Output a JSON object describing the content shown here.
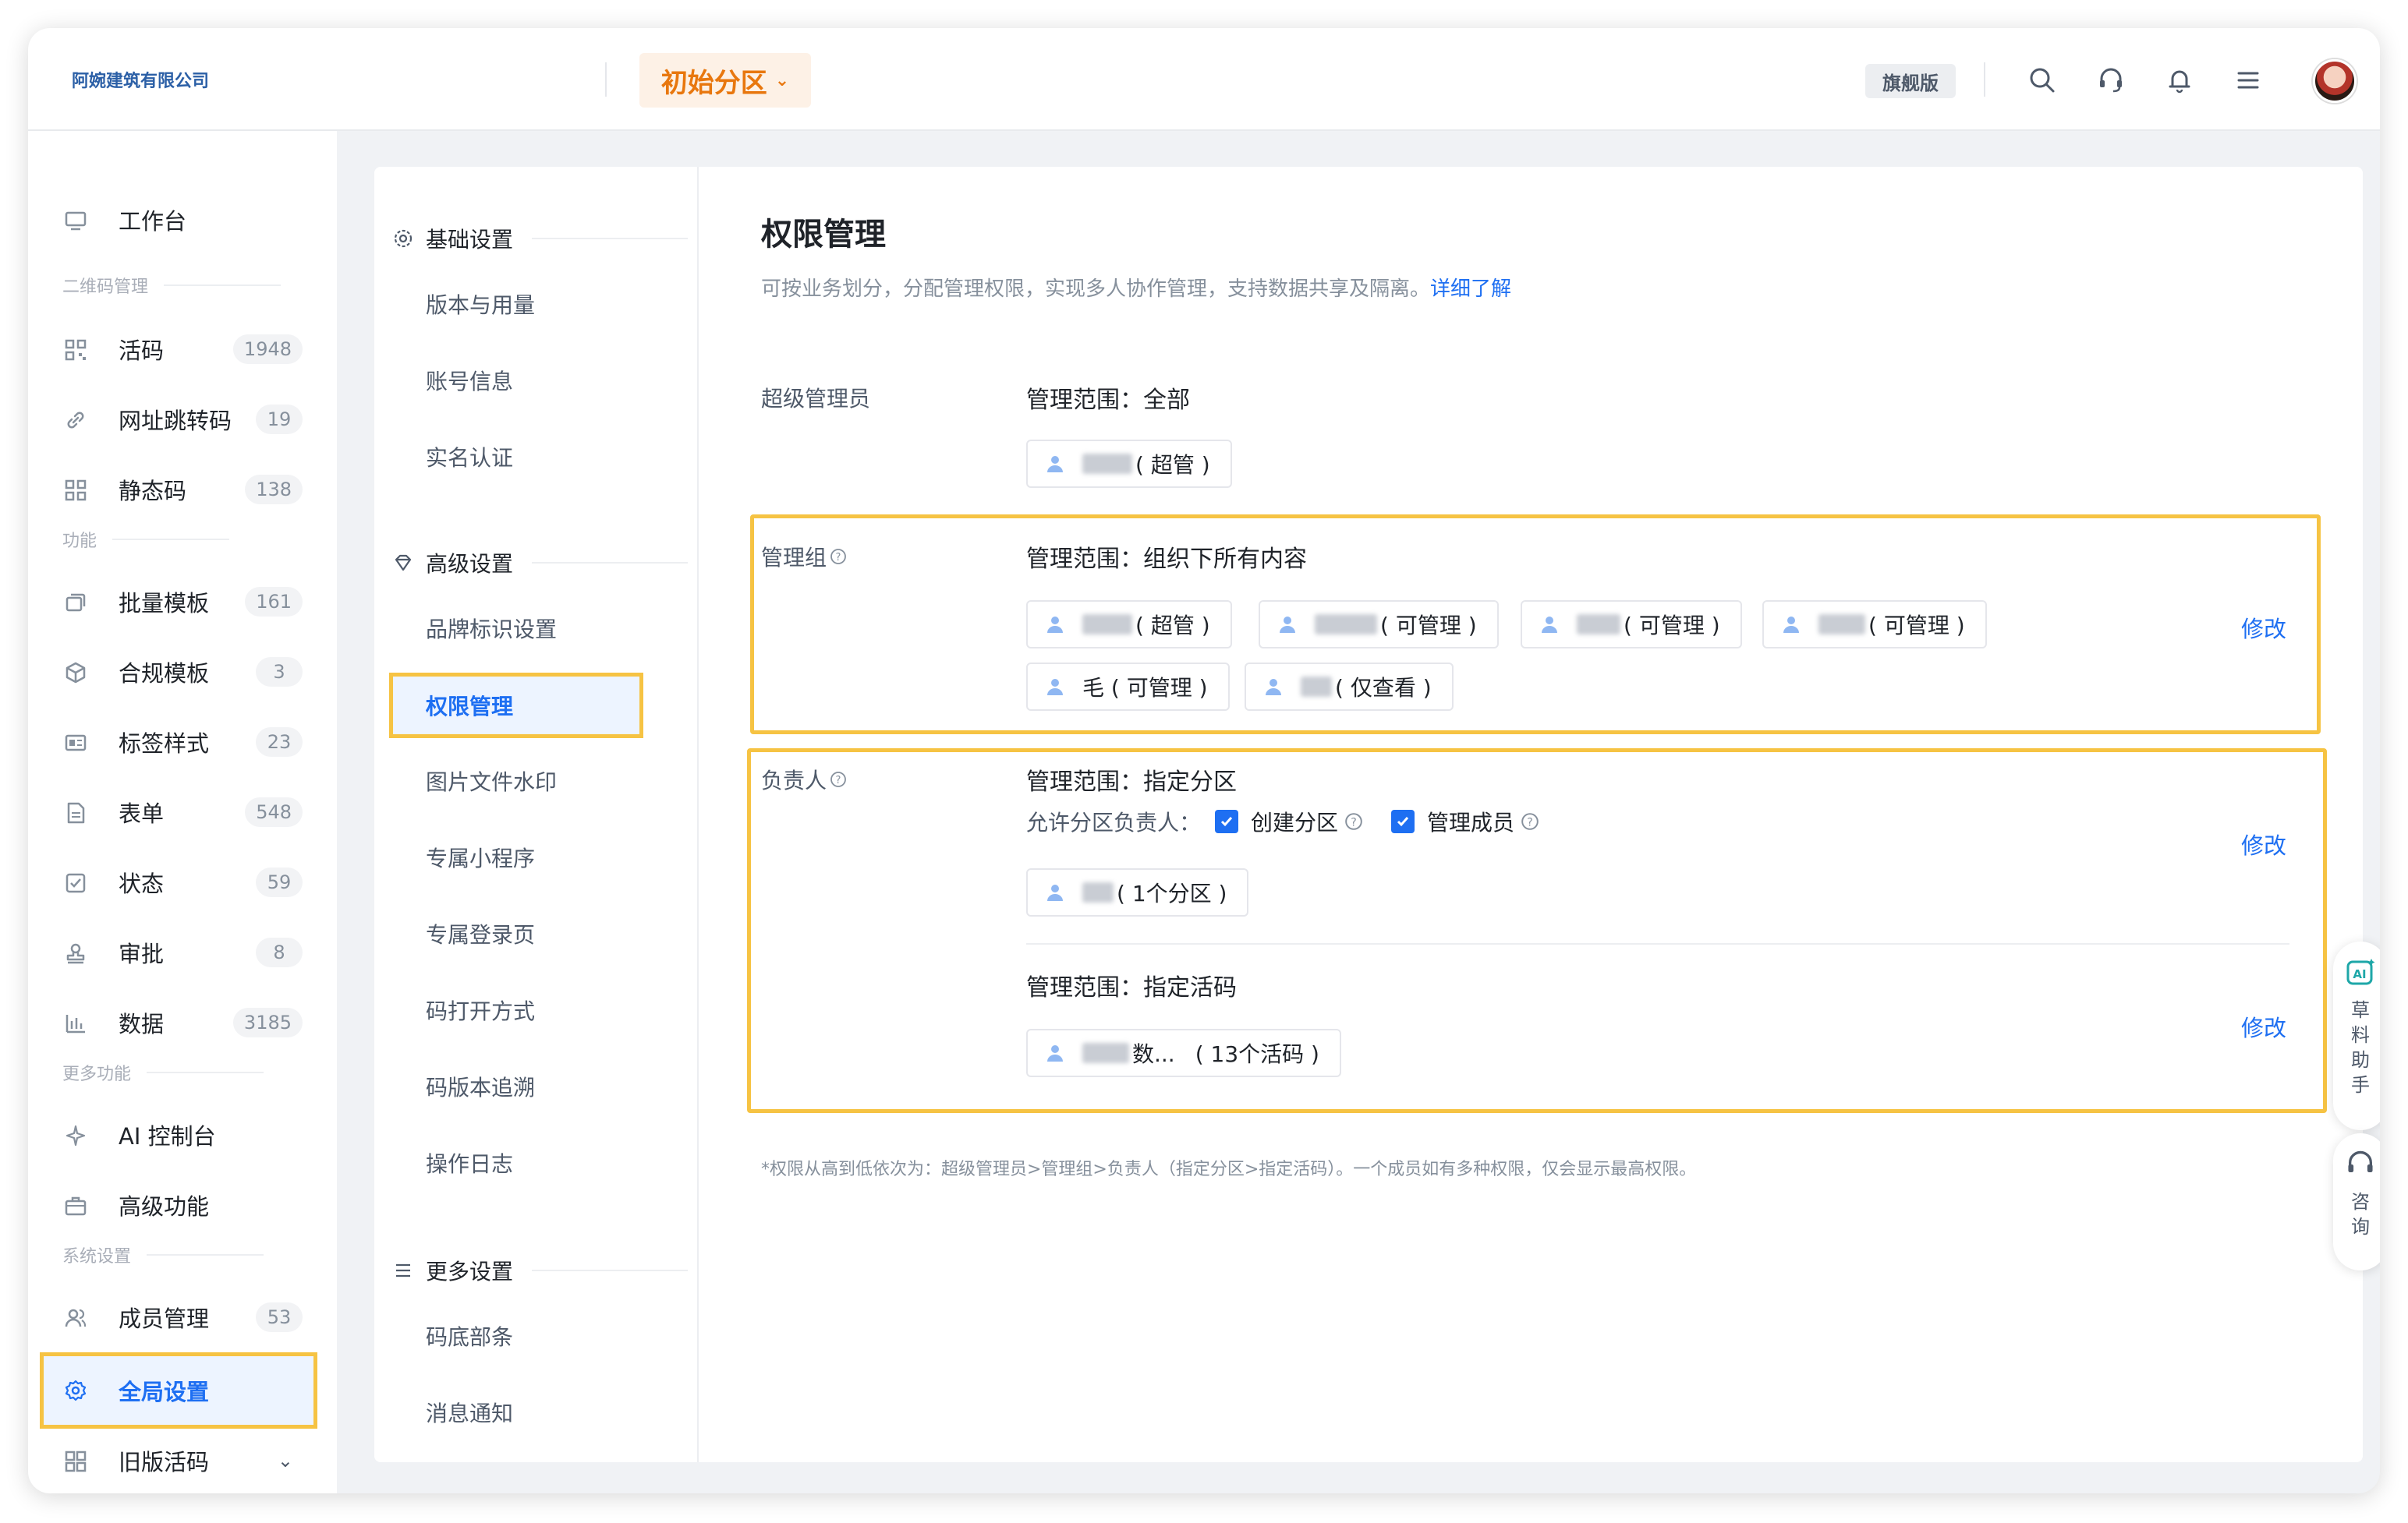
{
  "header": {
    "company": "阿婉建筑有限公司",
    "zone": "初始分区",
    "edition": "旗舰版"
  },
  "sidebar": {
    "workbench": "工作台",
    "section_qr": "二维码管理",
    "section_func": "功能",
    "section_more": "更多功能",
    "section_sys": "系统设置",
    "items": [
      {
        "label": "活码",
        "count": "1948"
      },
      {
        "label": "网址跳转码",
        "count": "19"
      },
      {
        "label": "静态码",
        "count": "138"
      },
      {
        "label": "批量模板",
        "count": "161"
      },
      {
        "label": "合规模板",
        "count": "3"
      },
      {
        "label": "标签样式",
        "count": "23"
      },
      {
        "label": "表单",
        "count": "548"
      },
      {
        "label": "状态",
        "count": "59"
      },
      {
        "label": "审批",
        "count": "8"
      },
      {
        "label": "数据",
        "count": "3185"
      },
      {
        "label": "AI 控制台"
      },
      {
        "label": "高级功能"
      },
      {
        "label": "成员管理",
        "count": "53"
      },
      {
        "label": "全局设置"
      },
      {
        "label": "旧版活码"
      }
    ]
  },
  "subnav": {
    "basic": "基础设置",
    "basic_items": [
      "版本与用量",
      "账号信息",
      "实名认证"
    ],
    "advanced": "高级设置",
    "advanced_items": [
      "品牌标识设置",
      "权限管理",
      "图片文件水印",
      "专属小程序",
      "专属登录页",
      "码打开方式",
      "码版本追溯",
      "操作日志"
    ],
    "more": "更多设置",
    "more_items": [
      "码底部条",
      "消息通知"
    ]
  },
  "content": {
    "title": "权限管理",
    "desc": "可按业务划分，分配管理权限，实现多人协作管理，支持数据共享及隔离。",
    "desc_link": "详细了解",
    "super_label": "超级管理员",
    "super_scope": "管理范围：全部",
    "super_chip": "( 超管 )",
    "group_label": "管理组",
    "group_scope": "管理范围：组织下所有内容",
    "group_chips": [
      "( 超管 )",
      "( 可管理 )",
      "( 可管理 )",
      "( 可管理 )",
      "毛 ( 可管理 )",
      "( 仅查看 )"
    ],
    "owner_label": "负责人",
    "owner_scope1": "管理范围：指定分区",
    "owner_allow": "允许分区负责人：",
    "owner_opt1": "创建分区",
    "owner_opt2": "管理成员",
    "owner_chip1": "( 1个分区 )",
    "owner_scope2": "管理范围：指定活码",
    "owner_chip2_name": "数...",
    "owner_chip2": "( 13个活码 )",
    "edit": "修改",
    "footnote": "*权限从高到低依次为：超级管理员>管理组>负责人（指定分区>指定活码）。一个成员如有多种权限，仅会显示最高权限。"
  },
  "floats": {
    "assistant": "草料助手",
    "consult": "咨询"
  },
  "colors": {
    "accent": "#1e6ff2",
    "zone": "#e8770e",
    "highlight": "#f6c343"
  }
}
